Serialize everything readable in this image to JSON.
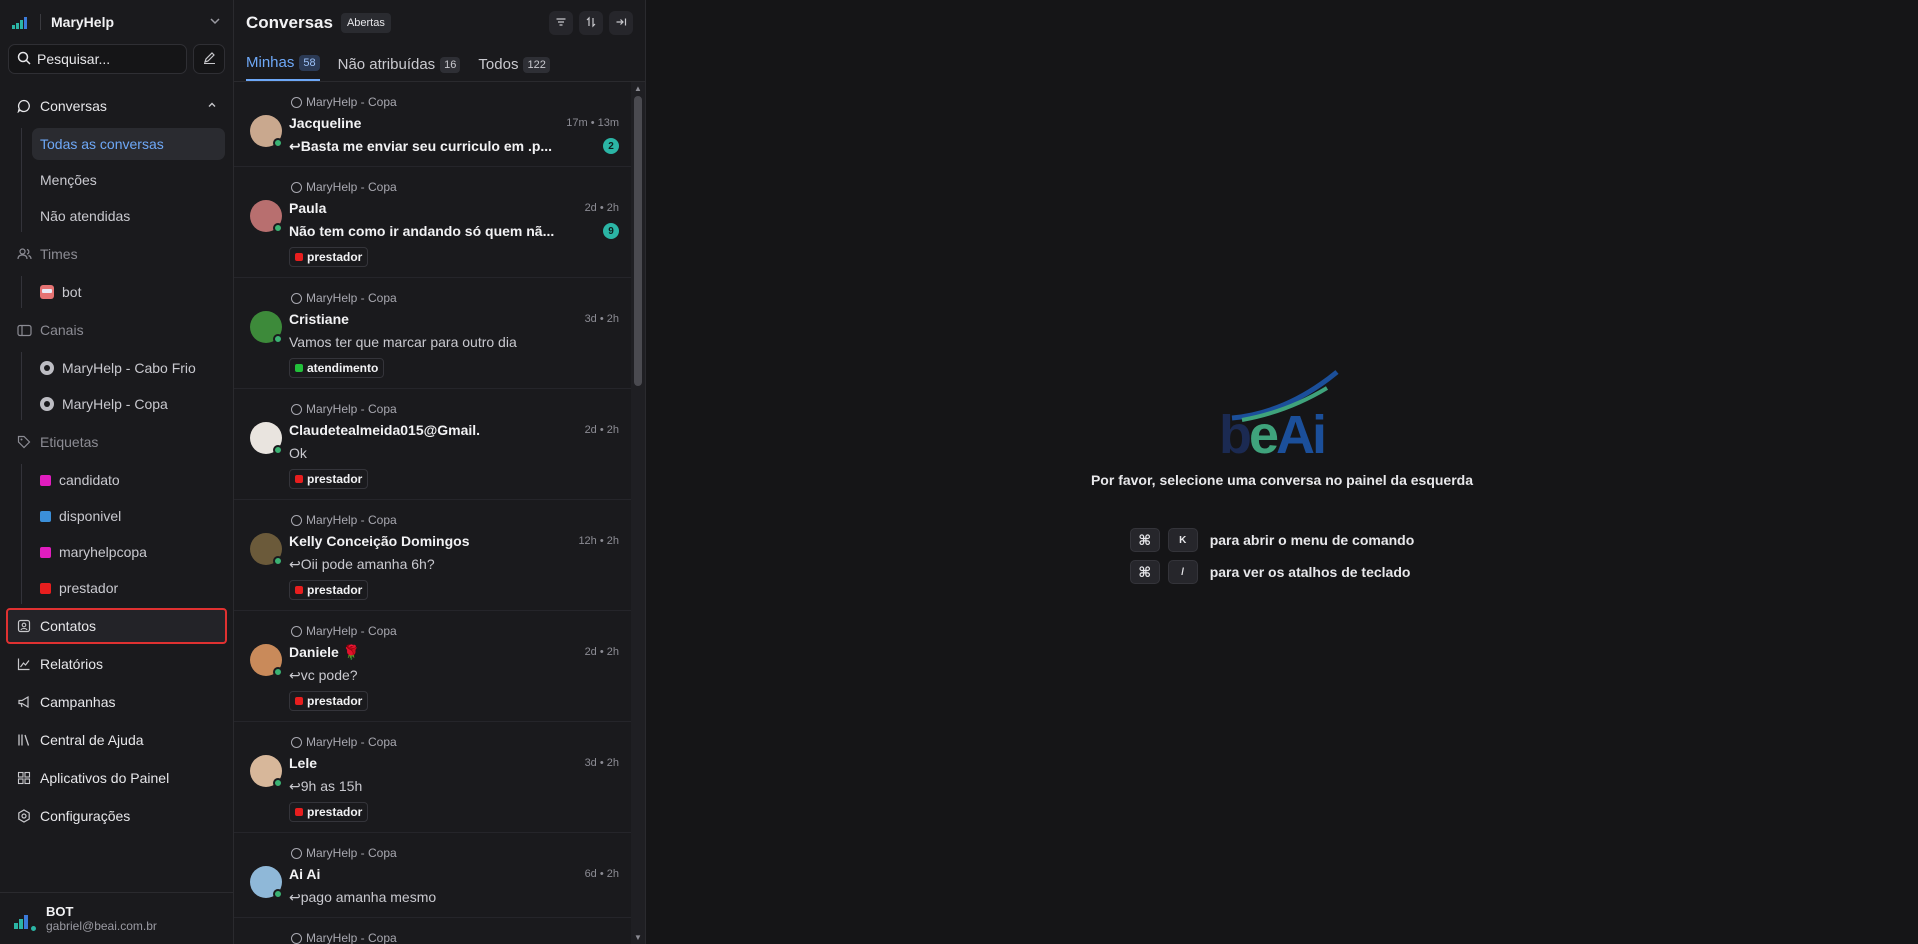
{
  "account": {
    "name": "MaryHelp",
    "search_placeholder": "Pesquisar..."
  },
  "nav": {
    "conversations": "Conversas",
    "conversation_items": [
      "Todas as conversas",
      "Menções",
      "Não atendidas"
    ],
    "teams": "Times",
    "team_items": [
      "bot"
    ],
    "channels": "Canais",
    "channel_items": [
      "MaryHelp - Cabo Frio",
      "MaryHelp - Copa"
    ],
    "labels": "Etiquetas",
    "label_items": [
      {
        "name": "candidato",
        "color": "#e11dbf"
      },
      {
        "name": "disponivel",
        "color": "#3b8fd9"
      },
      {
        "name": "maryhelpcopa",
        "color": "#e11dbf"
      },
      {
        "name": "prestador",
        "color": "#e81e1e"
      }
    ],
    "contacts": "Contatos",
    "reports": "Relatórios",
    "campaigns": "Campanhas",
    "help_center": "Central de Ajuda",
    "apps": "Aplicativos do Painel",
    "settings": "Configurações"
  },
  "user": {
    "name": "BOT",
    "email": "gabriel@beai.com.br"
  },
  "list": {
    "title": "Conversas",
    "status": "Abertas",
    "tabs": [
      {
        "label": "Minhas",
        "count": "58"
      },
      {
        "label": "Não atribuídas",
        "count": "16"
      },
      {
        "label": "Todos",
        "count": "122"
      }
    ]
  },
  "conversations": [
    {
      "inbox": "MaryHelp - Copa",
      "name": "Jacqueline",
      "time": "17m • 13m",
      "message": "Basta me enviar seu curriculo em .p...",
      "reply": true,
      "bold": true,
      "unread": "2",
      "label": "",
      "label_color": "",
      "avatar_color": "#c9a88e"
    },
    {
      "inbox": "MaryHelp - Copa",
      "name": "Paula",
      "time": "2d • 2h",
      "message": "Não tem como ir andando só quem nã...",
      "reply": false,
      "bold": true,
      "unread": "9",
      "label": "prestador",
      "label_color": "#e81e1e",
      "avatar_color": "#b86f6f"
    },
    {
      "inbox": "MaryHelp - Copa",
      "name": "Cristiane",
      "time": "3d • 2h",
      "message": "Vamos ter que marcar para outro dia",
      "reply": false,
      "bold": false,
      "unread": "",
      "label": "atendimento",
      "label_color": "#22c03a",
      "avatar_color": "#3d8a3a"
    },
    {
      "inbox": "MaryHelp - Copa",
      "name": "Claudetealmeida015@Gmail.",
      "time": "2d • 2h",
      "message": "Ok",
      "reply": false,
      "bold": false,
      "unread": "",
      "label": "prestador",
      "label_color": "#e81e1e",
      "avatar_color": "#e9e4df"
    },
    {
      "inbox": "MaryHelp - Copa",
      "name": "Kelly Conceição Domingos",
      "time": "12h • 2h",
      "message": "Oii pode amanha 6h?",
      "reply": true,
      "bold": false,
      "unread": "",
      "label": "prestador",
      "label_color": "#e81e1e",
      "avatar_color": "#6b5a3a"
    },
    {
      "inbox": "MaryHelp - Copa",
      "name": "Daniele 🌹",
      "time": "2d • 2h",
      "message": "vc pode?",
      "reply": true,
      "bold": false,
      "unread": "",
      "label": "prestador",
      "label_color": "#e81e1e",
      "avatar_color": "#c98a5a"
    },
    {
      "inbox": "MaryHelp - Copa",
      "name": "Lele",
      "time": "3d • 2h",
      "message": "9h as 15h",
      "reply": true,
      "bold": false,
      "unread": "",
      "label": "prestador",
      "label_color": "#e81e1e",
      "avatar_color": "#d7b79a"
    },
    {
      "inbox": "MaryHelp - Copa",
      "name": "Ai Ai",
      "time": "6d • 2h",
      "message": "pago amanha mesmo",
      "reply": true,
      "bold": false,
      "unread": "",
      "label": "",
      "label_color": "",
      "avatar_color": "#8fb8d8"
    },
    {
      "inbox": "MaryHelp - Copa",
      "name": "",
      "time": "",
      "message": "",
      "reply": false,
      "bold": false,
      "unread": "",
      "label": "",
      "label_color": "",
      "avatar_color": ""
    }
  ],
  "empty_state": {
    "brand": "beAi",
    "message": "Por favor, selecione uma conversa no painel da esquerda",
    "shortcut_1_key": "K",
    "shortcut_1_text": "para abrir o menu de comando",
    "shortcut_2_key": "/",
    "shortcut_2_text": "para ver os atalhos de teclado",
    "cmd_symbol": "⌘"
  }
}
